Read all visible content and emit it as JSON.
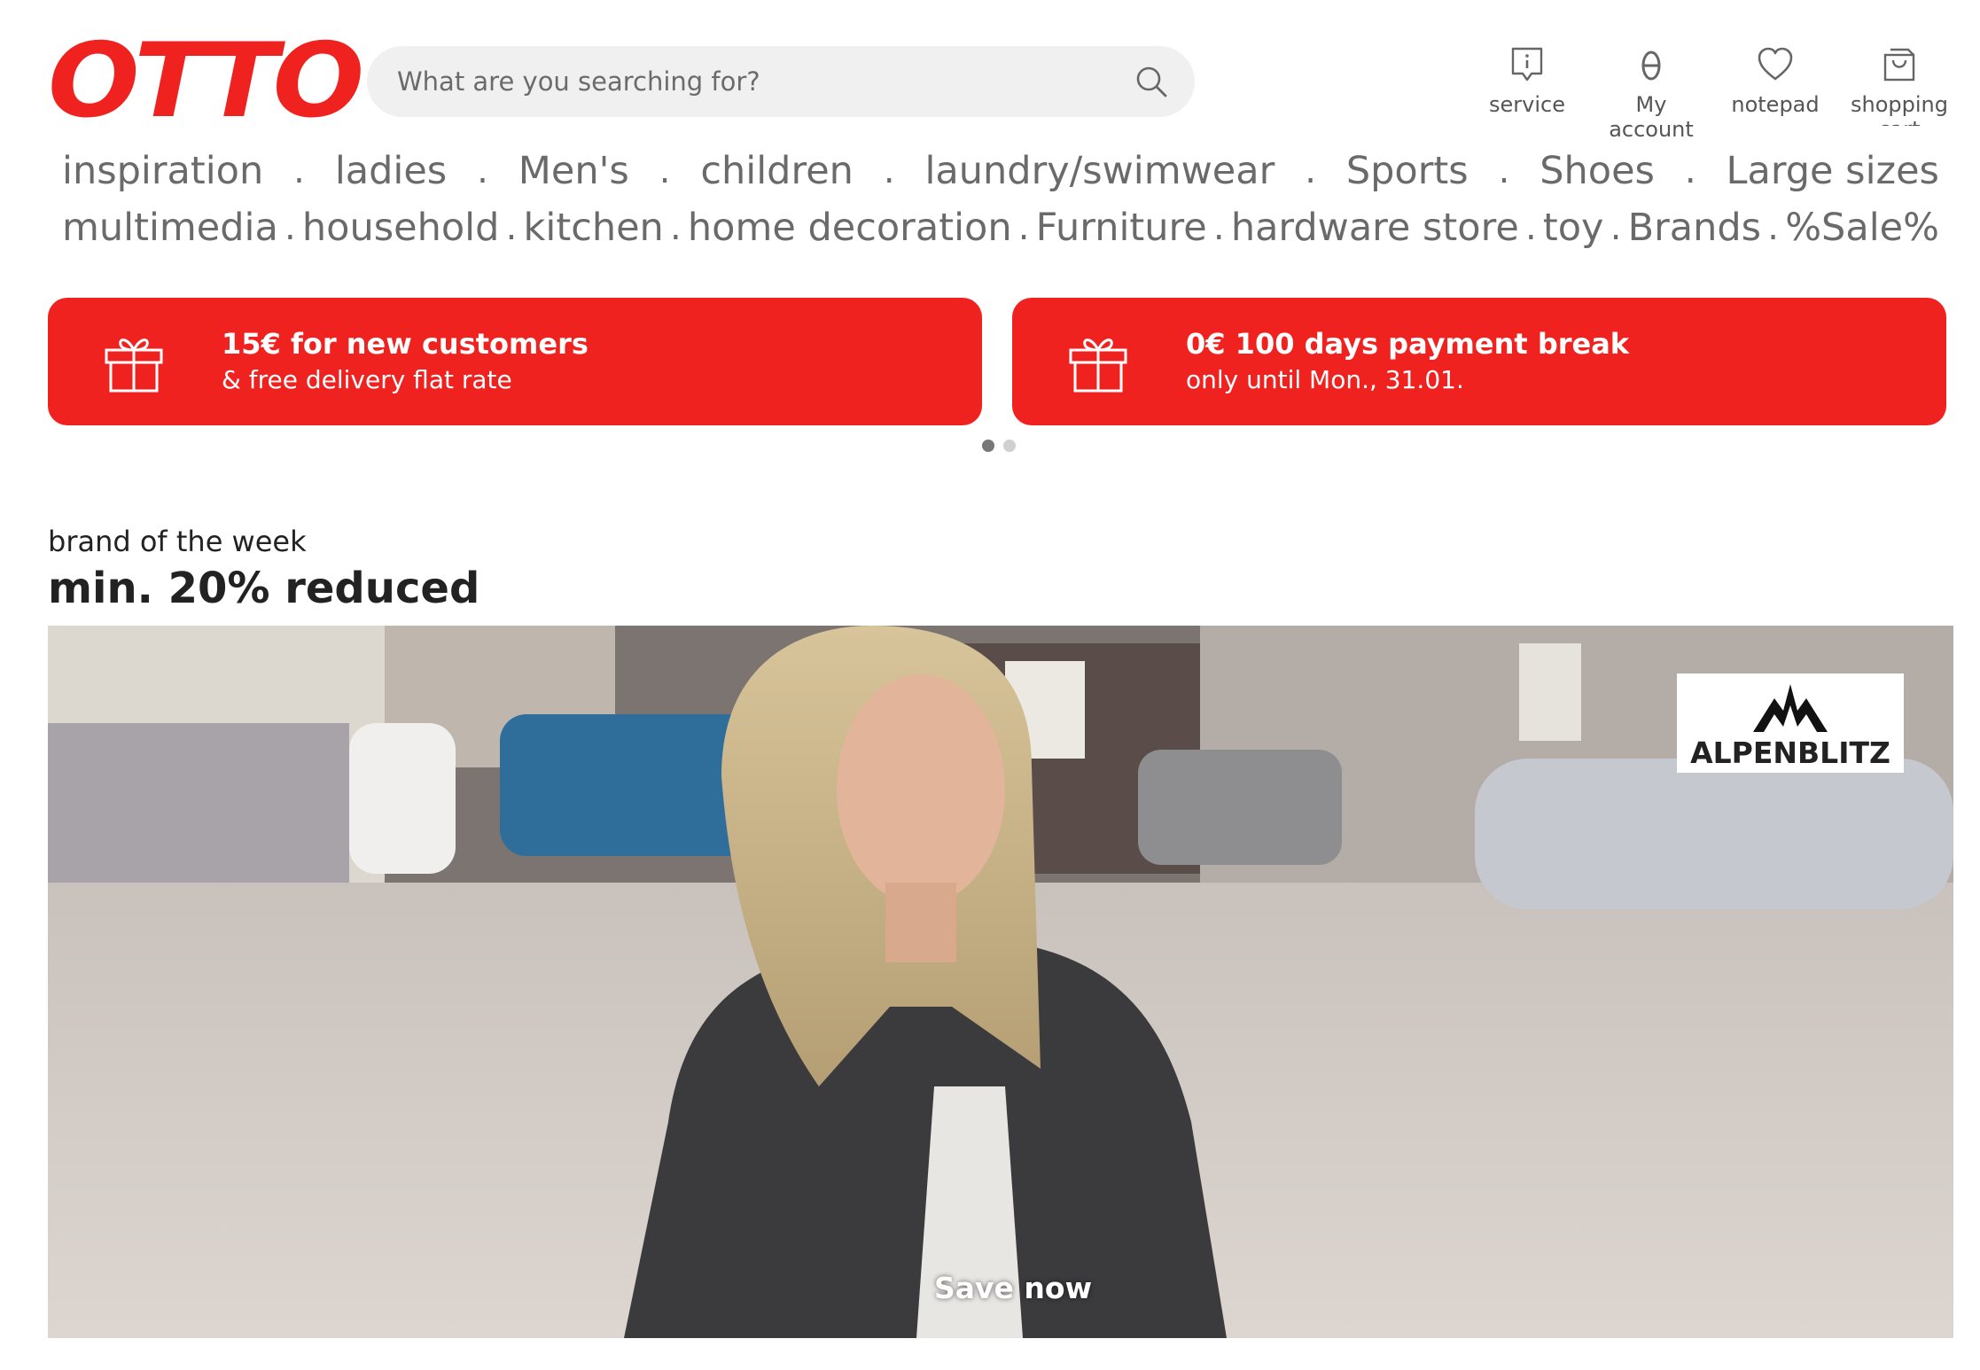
{
  "header": {
    "logo": "OTTO",
    "search_placeholder": "What are you searching for?",
    "icons": [
      {
        "label": "service",
        "icon": "info-bubble-icon"
      },
      {
        "label": "My account",
        "icon": "user-icon"
      },
      {
        "label": "notepad",
        "icon": "heart-icon"
      },
      {
        "label": "shopping cart",
        "icon": "shopping-bag-icon"
      }
    ]
  },
  "nav": {
    "row1": [
      "inspiration",
      "ladies",
      "Men's",
      "children",
      "laundry/swimwear",
      "Sports",
      "Shoes",
      "Large sizes"
    ],
    "row2": [
      "multimedia",
      "household",
      "kitchen",
      "home decoration",
      "Furniture",
      "hardware store",
      "toy",
      "Brands",
      "%Sale%"
    ],
    "separator": "."
  },
  "promos": [
    {
      "title": "15€ for new customers",
      "subtitle": "& free delivery flat rate",
      "icon": "gift-icon"
    },
    {
      "title": "0€ 100 days payment break",
      "subtitle": "only until Mon., 31.01.",
      "icon": "gift-icon"
    }
  ],
  "carousel": {
    "pages": 2,
    "active": 1
  },
  "brand_week": {
    "subtitle": "brand of the week",
    "title": "min. 20% reduced",
    "brand": "ALPENBLITZ",
    "cta": "Save now"
  },
  "colors": {
    "brand_red": "#f0221f"
  }
}
